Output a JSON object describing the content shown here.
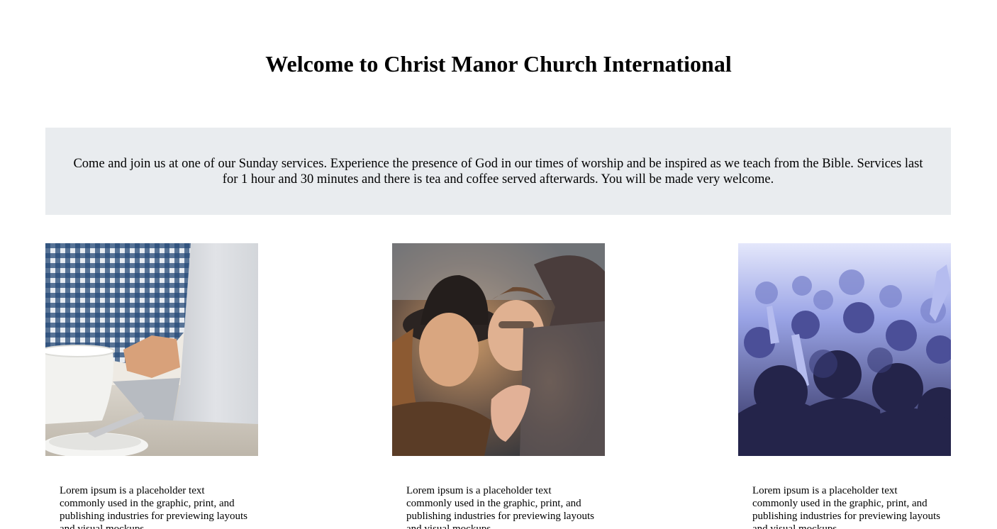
{
  "header": {
    "title": "Welcome to Christ Manor Church International"
  },
  "intro": {
    "text": "Come and join us at one of our Sunday services. Experience the presence of God in our times of worship and be inspired as we teach from the Bible. Services last for 1 hour and 30 minutes and there is tea and coffee served afterwards. You will be made very welcome."
  },
  "cards": [
    {
      "image": "laptop-coffee-photo",
      "text": "Lorem ipsum is a placeholder text commonly used in the graphic, print, and publishing industries for previewing layouts and visual mockups."
    },
    {
      "image": "women-laughing-photo",
      "text": "Lorem ipsum is a placeholder text commonly used in the graphic, print, and publishing industries for previewing layouts and visual mockups."
    },
    {
      "image": "worship-crowd-photo",
      "text": "Lorem ipsum is a placeholder text commonly used in the graphic, print, and publishing industries for previewing layouts and visual mockups."
    }
  ],
  "colors": {
    "banner_background": "#e9ecef",
    "text": "#000000",
    "page_background": "#ffffff"
  }
}
